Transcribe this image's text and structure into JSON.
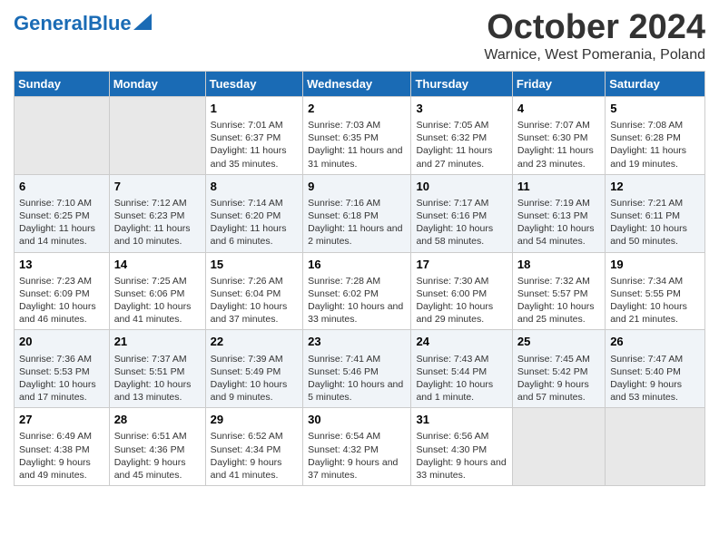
{
  "header": {
    "logo_general": "General",
    "logo_blue": "Blue",
    "month_title": "October 2024",
    "location": "Warnice, West Pomerania, Poland"
  },
  "weekdays": [
    "Sunday",
    "Monday",
    "Tuesday",
    "Wednesday",
    "Thursday",
    "Friday",
    "Saturday"
  ],
  "weeks": [
    [
      {
        "day": "",
        "info": ""
      },
      {
        "day": "",
        "info": ""
      },
      {
        "day": "1",
        "info": "Sunrise: 7:01 AM\nSunset: 6:37 PM\nDaylight: 11 hours and 35 minutes."
      },
      {
        "day": "2",
        "info": "Sunrise: 7:03 AM\nSunset: 6:35 PM\nDaylight: 11 hours and 31 minutes."
      },
      {
        "day": "3",
        "info": "Sunrise: 7:05 AM\nSunset: 6:32 PM\nDaylight: 11 hours and 27 minutes."
      },
      {
        "day": "4",
        "info": "Sunrise: 7:07 AM\nSunset: 6:30 PM\nDaylight: 11 hours and 23 minutes."
      },
      {
        "day": "5",
        "info": "Sunrise: 7:08 AM\nSunset: 6:28 PM\nDaylight: 11 hours and 19 minutes."
      }
    ],
    [
      {
        "day": "6",
        "info": "Sunrise: 7:10 AM\nSunset: 6:25 PM\nDaylight: 11 hours and 14 minutes."
      },
      {
        "day": "7",
        "info": "Sunrise: 7:12 AM\nSunset: 6:23 PM\nDaylight: 11 hours and 10 minutes."
      },
      {
        "day": "8",
        "info": "Sunrise: 7:14 AM\nSunset: 6:20 PM\nDaylight: 11 hours and 6 minutes."
      },
      {
        "day": "9",
        "info": "Sunrise: 7:16 AM\nSunset: 6:18 PM\nDaylight: 11 hours and 2 minutes."
      },
      {
        "day": "10",
        "info": "Sunrise: 7:17 AM\nSunset: 6:16 PM\nDaylight: 10 hours and 58 minutes."
      },
      {
        "day": "11",
        "info": "Sunrise: 7:19 AM\nSunset: 6:13 PM\nDaylight: 10 hours and 54 minutes."
      },
      {
        "day": "12",
        "info": "Sunrise: 7:21 AM\nSunset: 6:11 PM\nDaylight: 10 hours and 50 minutes."
      }
    ],
    [
      {
        "day": "13",
        "info": "Sunrise: 7:23 AM\nSunset: 6:09 PM\nDaylight: 10 hours and 46 minutes."
      },
      {
        "day": "14",
        "info": "Sunrise: 7:25 AM\nSunset: 6:06 PM\nDaylight: 10 hours and 41 minutes."
      },
      {
        "day": "15",
        "info": "Sunrise: 7:26 AM\nSunset: 6:04 PM\nDaylight: 10 hours and 37 minutes."
      },
      {
        "day": "16",
        "info": "Sunrise: 7:28 AM\nSunset: 6:02 PM\nDaylight: 10 hours and 33 minutes."
      },
      {
        "day": "17",
        "info": "Sunrise: 7:30 AM\nSunset: 6:00 PM\nDaylight: 10 hours and 29 minutes."
      },
      {
        "day": "18",
        "info": "Sunrise: 7:32 AM\nSunset: 5:57 PM\nDaylight: 10 hours and 25 minutes."
      },
      {
        "day": "19",
        "info": "Sunrise: 7:34 AM\nSunset: 5:55 PM\nDaylight: 10 hours and 21 minutes."
      }
    ],
    [
      {
        "day": "20",
        "info": "Sunrise: 7:36 AM\nSunset: 5:53 PM\nDaylight: 10 hours and 17 minutes."
      },
      {
        "day": "21",
        "info": "Sunrise: 7:37 AM\nSunset: 5:51 PM\nDaylight: 10 hours and 13 minutes."
      },
      {
        "day": "22",
        "info": "Sunrise: 7:39 AM\nSunset: 5:49 PM\nDaylight: 10 hours and 9 minutes."
      },
      {
        "day": "23",
        "info": "Sunrise: 7:41 AM\nSunset: 5:46 PM\nDaylight: 10 hours and 5 minutes."
      },
      {
        "day": "24",
        "info": "Sunrise: 7:43 AM\nSunset: 5:44 PM\nDaylight: 10 hours and 1 minute."
      },
      {
        "day": "25",
        "info": "Sunrise: 7:45 AM\nSunset: 5:42 PM\nDaylight: 9 hours and 57 minutes."
      },
      {
        "day": "26",
        "info": "Sunrise: 7:47 AM\nSunset: 5:40 PM\nDaylight: 9 hours and 53 minutes."
      }
    ],
    [
      {
        "day": "27",
        "info": "Sunrise: 6:49 AM\nSunset: 4:38 PM\nDaylight: 9 hours and 49 minutes."
      },
      {
        "day": "28",
        "info": "Sunrise: 6:51 AM\nSunset: 4:36 PM\nDaylight: 9 hours and 45 minutes."
      },
      {
        "day": "29",
        "info": "Sunrise: 6:52 AM\nSunset: 4:34 PM\nDaylight: 9 hours and 41 minutes."
      },
      {
        "day": "30",
        "info": "Sunrise: 6:54 AM\nSunset: 4:32 PM\nDaylight: 9 hours and 37 minutes."
      },
      {
        "day": "31",
        "info": "Sunrise: 6:56 AM\nSunset: 4:30 PM\nDaylight: 9 hours and 33 minutes."
      },
      {
        "day": "",
        "info": ""
      },
      {
        "day": "",
        "info": ""
      }
    ]
  ]
}
